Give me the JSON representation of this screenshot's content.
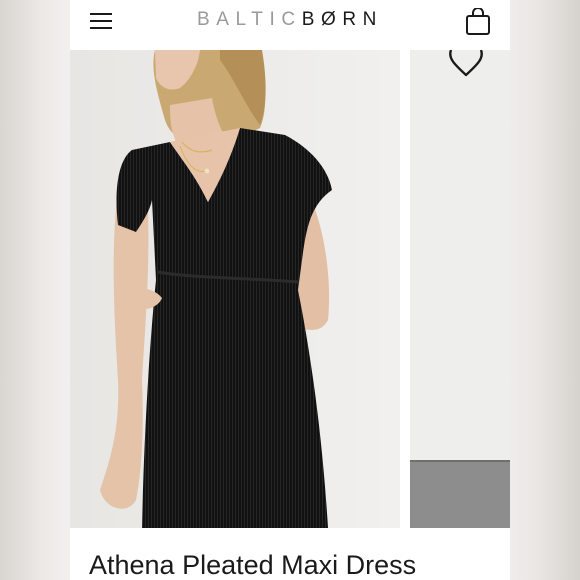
{
  "header": {
    "brand_left": "BALTIC",
    "brand_right": "BØRN",
    "menu_icon": "hamburger-menu-icon",
    "bag_icon": "shopping-bag-icon"
  },
  "gallery": {
    "wishlist_icon": "heart-icon",
    "main_image_alt": "Woman wearing black pleated maxi dress"
  },
  "product": {
    "title": "Athena Pleated Maxi Dress"
  },
  "colors": {
    "brand_text": "#9a9a9a",
    "dark_text": "#1a1a1a",
    "dress": "#121212"
  }
}
